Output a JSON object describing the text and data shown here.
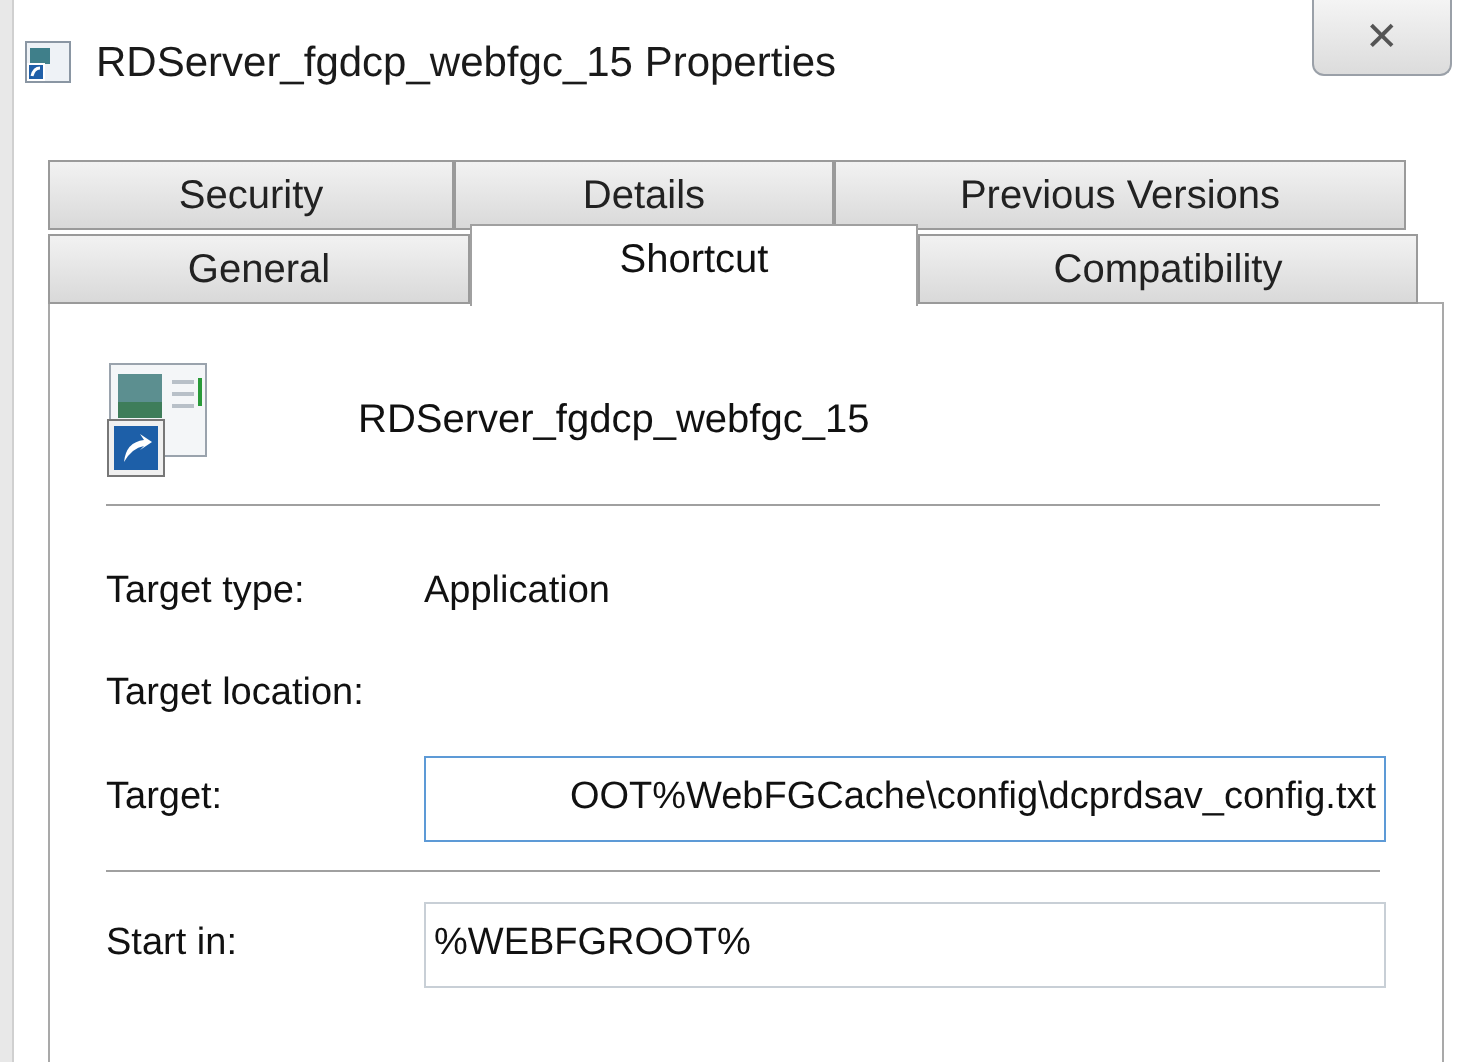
{
  "window": {
    "title": "RDServer_fgdcp_webfgc_15 Properties",
    "close": "✕"
  },
  "tab_rows": [
    [
      {
        "label": "Security",
        "selected": false
      },
      {
        "label": "Details",
        "selected": false
      },
      {
        "label": "Previous Versions",
        "selected": false
      }
    ],
    [
      {
        "label": "General",
        "selected": false
      },
      {
        "label": "Shortcut",
        "selected": true
      },
      {
        "label": "Compatibility",
        "selected": false
      }
    ]
  ],
  "shortcut_name": "RDServer_fgdcp_webfgc_15",
  "fields": [
    {
      "kind": "info",
      "label": "Target type:",
      "value": "Application"
    },
    {
      "kind": "info",
      "label": "Target location:"
    },
    {
      "kind": "input",
      "label": "Target:",
      "value": "OOT%WebFGCache\\config\\dcprdsav_config.txt",
      "focused": true
    },
    {
      "kind": "divider"
    },
    {
      "kind": "input",
      "label": "Start in:",
      "value": "%WEBFGROOT%",
      "focused": false
    }
  ]
}
